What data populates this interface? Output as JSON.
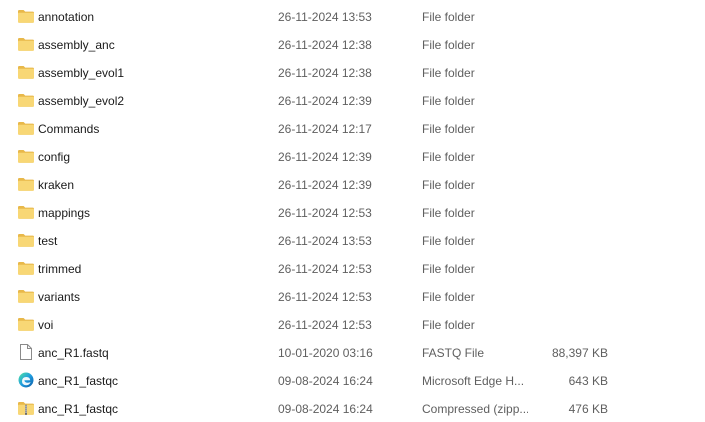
{
  "files": [
    {
      "name": "annotation",
      "date": "26-11-2024 13:53",
      "type": "File folder",
      "size": "",
      "icon": "folder-icon"
    },
    {
      "name": "assembly_anc",
      "date": "26-11-2024 12:38",
      "type": "File folder",
      "size": "",
      "icon": "folder-icon"
    },
    {
      "name": "assembly_evol1",
      "date": "26-11-2024 12:38",
      "type": "File folder",
      "size": "",
      "icon": "folder-icon"
    },
    {
      "name": "assembly_evol2",
      "date": "26-11-2024 12:39",
      "type": "File folder",
      "size": "",
      "icon": "folder-icon"
    },
    {
      "name": "Commands",
      "date": "26-11-2024 12:17",
      "type": "File folder",
      "size": "",
      "icon": "folder-icon"
    },
    {
      "name": "config",
      "date": "26-11-2024 12:39",
      "type": "File folder",
      "size": "",
      "icon": "folder-icon"
    },
    {
      "name": "kraken",
      "date": "26-11-2024 12:39",
      "type": "File folder",
      "size": "",
      "icon": "folder-icon"
    },
    {
      "name": "mappings",
      "date": "26-11-2024 12:53",
      "type": "File folder",
      "size": "",
      "icon": "folder-icon"
    },
    {
      "name": "test",
      "date": "26-11-2024 13:53",
      "type": "File folder",
      "size": "",
      "icon": "folder-icon"
    },
    {
      "name": "trimmed",
      "date": "26-11-2024 12:53",
      "type": "File folder",
      "size": "",
      "icon": "folder-icon"
    },
    {
      "name": "variants",
      "date": "26-11-2024 12:53",
      "type": "File folder",
      "size": "",
      "icon": "folder-icon"
    },
    {
      "name": "voi",
      "date": "26-11-2024 12:53",
      "type": "File folder",
      "size": "",
      "icon": "folder-icon"
    },
    {
      "name": "anc_R1.fastq",
      "date": "10-01-2020 03:16",
      "type": "FASTQ File",
      "size": "88,397 KB",
      "icon": "document-file-icon"
    },
    {
      "name": "anc_R1_fastqc",
      "date": "09-08-2024 16:24",
      "type": "Microsoft Edge H...",
      "size": "643 KB",
      "icon": "edge-browser-icon"
    },
    {
      "name": "anc_R1_fastqc",
      "date": "09-08-2024 16:24",
      "type": "Compressed (zipp...",
      "size": "476 KB",
      "icon": "zip-folder-icon"
    }
  ],
  "colors": {
    "folder_yellow": "#f8d775",
    "folder_dark": "#e8b84a",
    "edge_blue": "#0c59a4",
    "edge_green": "#50e6a0",
    "text_primary": "#1a1a1a",
    "text_secondary": "#5f5f5f"
  }
}
